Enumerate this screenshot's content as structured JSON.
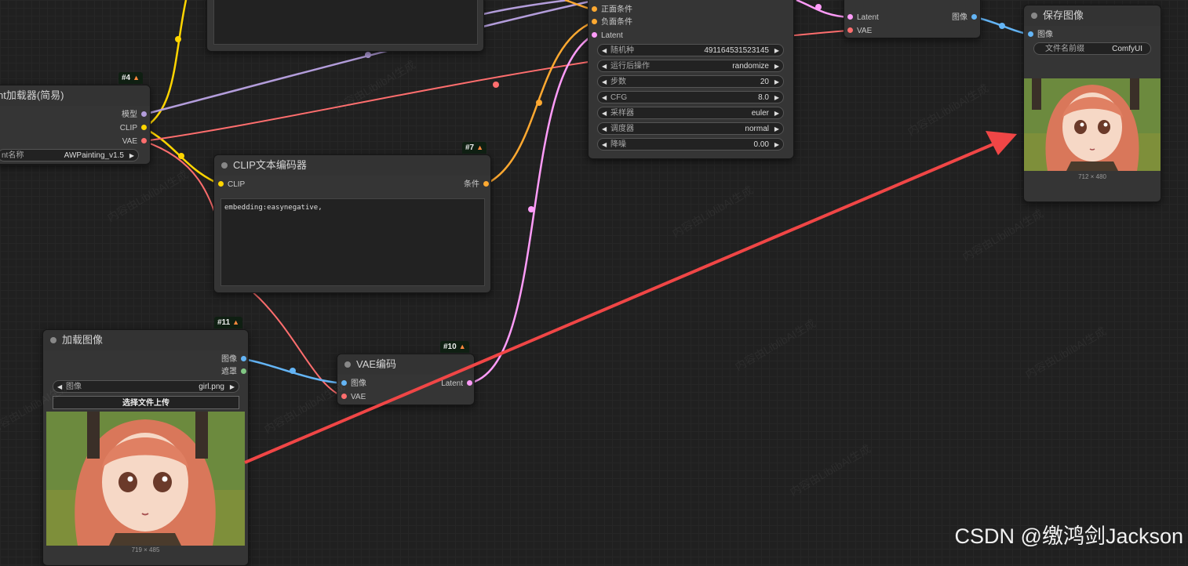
{
  "colors": {
    "model": "#b39ddb",
    "clip": "#ffd500",
    "vae": "#ff6e6e",
    "conditioning": "#ffa931",
    "latent": "#ff9cf9",
    "image": "#64b5f6",
    "mask": "#81c784",
    "annotation_arrow": "#f04646"
  },
  "checkpoint_node": {
    "id": "#4",
    "title": "nt加载器(简易)",
    "outputs": [
      "模型",
      "CLIP",
      "VAE"
    ],
    "widget_label": "nt名称",
    "widget_value": "AWPainting_v1.5"
  },
  "clip_node": {
    "id": "#7",
    "title": "CLIP文本编码器",
    "input": "CLIP",
    "output": "条件",
    "text": "embedding:easynegative,"
  },
  "sampler_node": {
    "inputs": [
      "正面条件",
      "负面条件",
      "Latent"
    ],
    "widgets": [
      {
        "label": "随机种",
        "value": "491164531523145"
      },
      {
        "label": "运行后操作",
        "value": "randomize"
      },
      {
        "label": "步数",
        "value": "20"
      },
      {
        "label": "CFG",
        "value": "8.0"
      },
      {
        "label": "采样器",
        "value": "euler"
      },
      {
        "label": "调度器",
        "value": "normal"
      },
      {
        "label": "降噪",
        "value": "0.00"
      }
    ]
  },
  "vae_decode_node": {
    "inputs": [
      "Latent",
      "VAE"
    ],
    "output": "图像"
  },
  "save_node": {
    "title": "保存图像",
    "input": "图像",
    "widget_label": "文件名前缀",
    "widget_value": "ComfyUI",
    "dims": "712 × 480"
  },
  "load_image_node": {
    "id": "#11",
    "title": "加载图像",
    "outputs": [
      "图像",
      "遮罩"
    ],
    "widget_label": "图像",
    "widget_value": "girl.png",
    "upload_label": "选择文件上传",
    "dims": "719 × 485"
  },
  "vae_encode_node": {
    "id": "#10",
    "title": "VAE编码",
    "inputs": [
      "图像",
      "VAE"
    ],
    "output": "Latent"
  },
  "watermark": "内容由LiblibAI生成",
  "credit": "CSDN @缴鸿剑Jackson"
}
